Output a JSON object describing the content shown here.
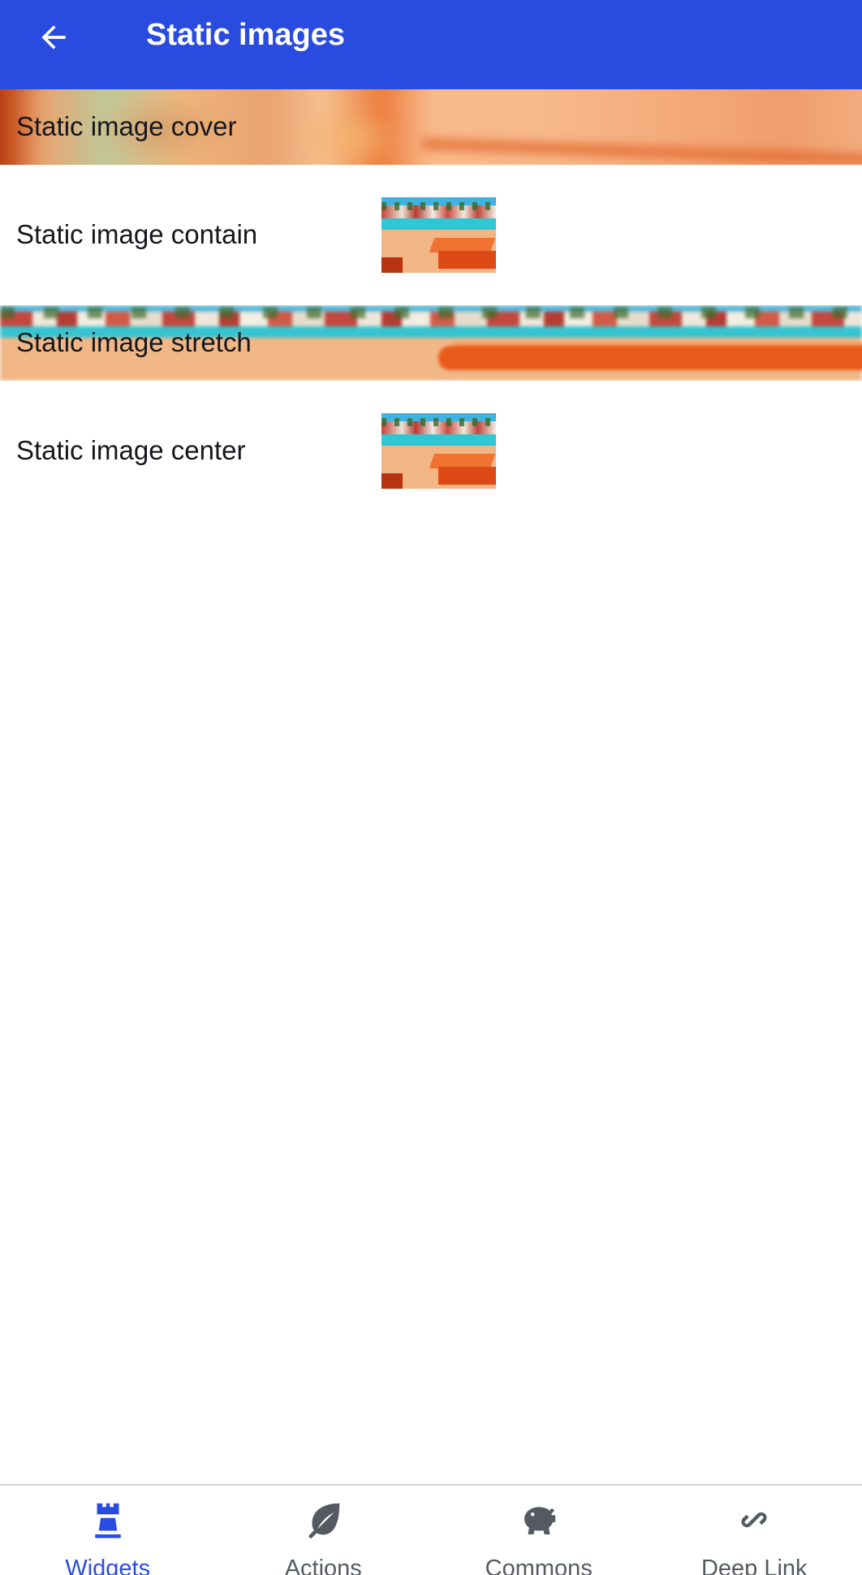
{
  "header": {
    "title": "Static images",
    "back_icon": "arrow-left-icon"
  },
  "rows": [
    {
      "label": "Static image cover",
      "image_mode": "cover"
    },
    {
      "label": "Static image contain",
      "image_mode": "contain"
    },
    {
      "label": "Static image stretch",
      "image_mode": "stretch"
    },
    {
      "label": "Static image center",
      "image_mode": "center"
    }
  ],
  "bottom_nav": {
    "items": [
      {
        "label": "Widgets",
        "icon": "rook-icon",
        "active": true
      },
      {
        "label": "Actions",
        "icon": "leaf-icon",
        "active": false
      },
      {
        "label": "Commons",
        "icon": "piggy-bank-icon",
        "active": false
      },
      {
        "label": "Deep Link",
        "icon": "link-icon",
        "active": false
      }
    ]
  },
  "colors": {
    "primary": "#2a4be0",
    "nav_inactive": "#555a62",
    "text": "#15171c"
  }
}
